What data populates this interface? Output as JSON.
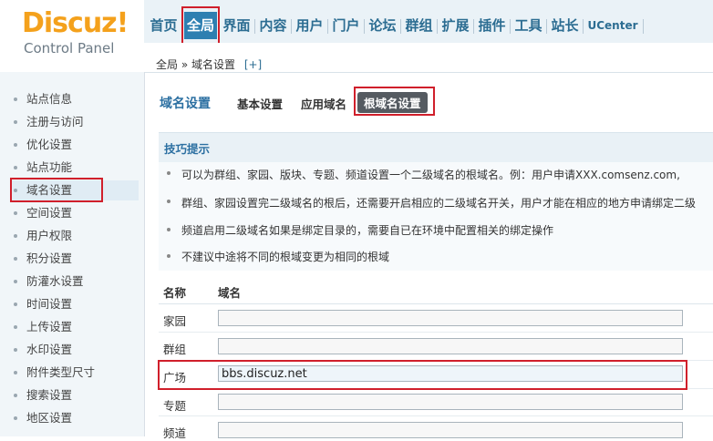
{
  "brand": {
    "name": "Discuz!",
    "subtitle": "Control Panel"
  },
  "topnav": {
    "items": [
      {
        "label": "首页"
      },
      {
        "label": "全局",
        "active": true
      },
      {
        "label": "界面"
      },
      {
        "label": "内容"
      },
      {
        "label": "用户"
      },
      {
        "label": "门户"
      },
      {
        "label": "论坛"
      },
      {
        "label": "群组"
      },
      {
        "label": "扩展"
      },
      {
        "label": "插件"
      },
      {
        "label": "工具"
      },
      {
        "label": "站长"
      },
      {
        "label": "UCenter"
      }
    ]
  },
  "breadcrumb": {
    "text": "全局 » 域名设置",
    "add": "[+]"
  },
  "sidebar": {
    "items": [
      {
        "label": "站点信息"
      },
      {
        "label": "注册与访问"
      },
      {
        "label": "优化设置"
      },
      {
        "label": "站点功能"
      },
      {
        "label": "域名设置",
        "active": true
      },
      {
        "label": "空间设置"
      },
      {
        "label": "用户权限"
      },
      {
        "label": "积分设置"
      },
      {
        "label": "防灌水设置"
      },
      {
        "label": "时间设置"
      },
      {
        "label": "上传设置"
      },
      {
        "label": "水印设置"
      },
      {
        "label": "附件类型尺寸"
      },
      {
        "label": "搜索设置"
      },
      {
        "label": "地区设置"
      }
    ]
  },
  "tabs": {
    "title": "域名设置",
    "items": [
      {
        "label": "基本设置"
      },
      {
        "label": "应用域名"
      },
      {
        "label": "根域名设置",
        "current": true
      }
    ]
  },
  "tips": {
    "title": "技巧提示",
    "lines": [
      "可以为群组、家园、版块、专题、频道设置一个二级域名的根域名。例：用户申请XXX.comsenz.com,",
      "群组、家园设置完二级域名的根后，还需要开启相应的二级域名开关，用户才能在相应的地方申请绑定二级",
      "频道启用二级域名如果是绑定目录的，需要自已在环境中配置相关的绑定操作",
      "不建议中途将不同的根域变更为相同的根域"
    ]
  },
  "table": {
    "headers": {
      "name": "名称",
      "domain": "域名"
    },
    "rows": [
      {
        "label": "家园",
        "value": ""
      },
      {
        "label": "群组",
        "value": ""
      },
      {
        "label": "广场",
        "value": "bbs.discuz.net"
      },
      {
        "label": "专题",
        "value": ""
      },
      {
        "label": "频道",
        "value": ""
      }
    ]
  },
  "colors": {
    "accent": "#2d7fb1",
    "brand": "#f4a11c",
    "highlight": "#d01f2b"
  }
}
